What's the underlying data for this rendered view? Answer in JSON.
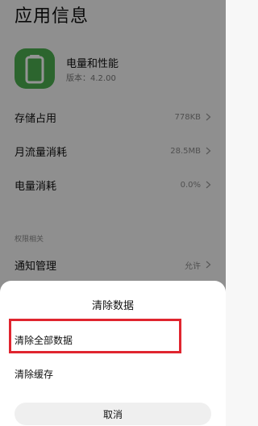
{
  "page": {
    "title": "应用信息"
  },
  "app": {
    "name": "电量和性能",
    "version": "版本：4.2.00"
  },
  "rows": [
    {
      "label": "存储占用",
      "value": "778KB"
    },
    {
      "label": "月流量消耗",
      "value": "28.5MB"
    },
    {
      "label": "电量消耗",
      "value": "0.0%"
    }
  ],
  "section": {
    "label": "权限相关"
  },
  "notification": {
    "label": "通知管理",
    "value": "允许"
  },
  "sheet": {
    "title": "清除数据",
    "options": [
      "清除全部数据",
      "清除缓存"
    ],
    "cancel": "取消"
  },
  "colors": {
    "app_icon": "#4caf50",
    "highlight": "#e0252f"
  }
}
